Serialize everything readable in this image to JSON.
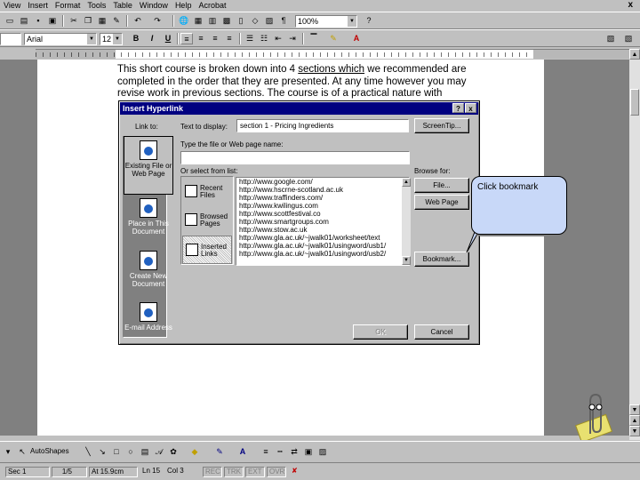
{
  "menu": {
    "items": [
      "View",
      "Insert",
      "Format",
      "Tools",
      "Table",
      "Window",
      "Help",
      "Acrobat"
    ],
    "close": "x"
  },
  "format_toolbar": {
    "style": "",
    "font": "Arial",
    "size": "12",
    "zoom": "100%",
    "bold": "B",
    "italic": "I",
    "underline": "U"
  },
  "document": {
    "line1_pre": "This short course is broken down into 4 ",
    "line1_link": "sections which",
    "line1_post": " we recommended are",
    "line2": "completed in the order that they are presented. At any time however you may",
    "line3": "revise work in previous sections. The course is of a practical nature with"
  },
  "dialog": {
    "title": "Insert Hyperlink",
    "help": "?",
    "close": "x",
    "link_to_label": "Link to:",
    "text_to_display_label": "Text to display:",
    "text_to_display_value": "section 1 - Pricing Ingredients",
    "screentip_button": "ScreenTip...",
    "file_or_web_label": "Type the file or Web page name:",
    "file_or_web_value": "",
    "select_from_list_label": "Or select from list:",
    "browse_for_label": "Browse for:",
    "file_button": "File...",
    "web_page_button": "Web Page",
    "bookmark_button": "Bookmark...",
    "ok_button": "OK",
    "cancel_button": "Cancel",
    "link_to_items": [
      {
        "label": "Existing File or Web Page",
        "active": true
      },
      {
        "label": "Place in This Document",
        "active": false
      },
      {
        "label": "Create New Document",
        "active": false
      },
      {
        "label": "E-mail Address",
        "active": false
      }
    ],
    "sub_items": [
      {
        "label": "Recent Files",
        "active": false
      },
      {
        "label": "Browsed Pages",
        "active": false
      },
      {
        "label": "Inserted Links",
        "active": true
      }
    ],
    "links": [
      "http://www.google.com/",
      "http://www.hscrne-scotland.ac.uk",
      "http://www.traffinders.com/",
      "http://www.kwilingus.com",
      "http://www.scottfestival.co",
      "http://www.smartgroups.com",
      "http://www.stow.ac.uk",
      "http://www.gla.ac.uk/~jwalk01/worksheet/text",
      "http://www.gla.ac.uk/~jwalk01/usingword/usb1/",
      "http://www.gla.ac.uk/~jwalk01/usingword/usb2/"
    ]
  },
  "callout": {
    "text": "Click bookmark",
    "color": "#c8d8f8"
  },
  "draw_toolbar": {
    "autoshapes": "AutoShapes"
  },
  "status": {
    "sec": "Sec 1",
    "pages": "1/5",
    "at": "At 15.9cm",
    "ln": "Ln 15",
    "col": "Col 3",
    "rec": "REC",
    "trk": "TRK",
    "ext": "EXT",
    "ovr": "OVR"
  },
  "colors": {
    "title_bar": "#000080",
    "face": "#c0c0c0",
    "desktop": "#808080"
  }
}
